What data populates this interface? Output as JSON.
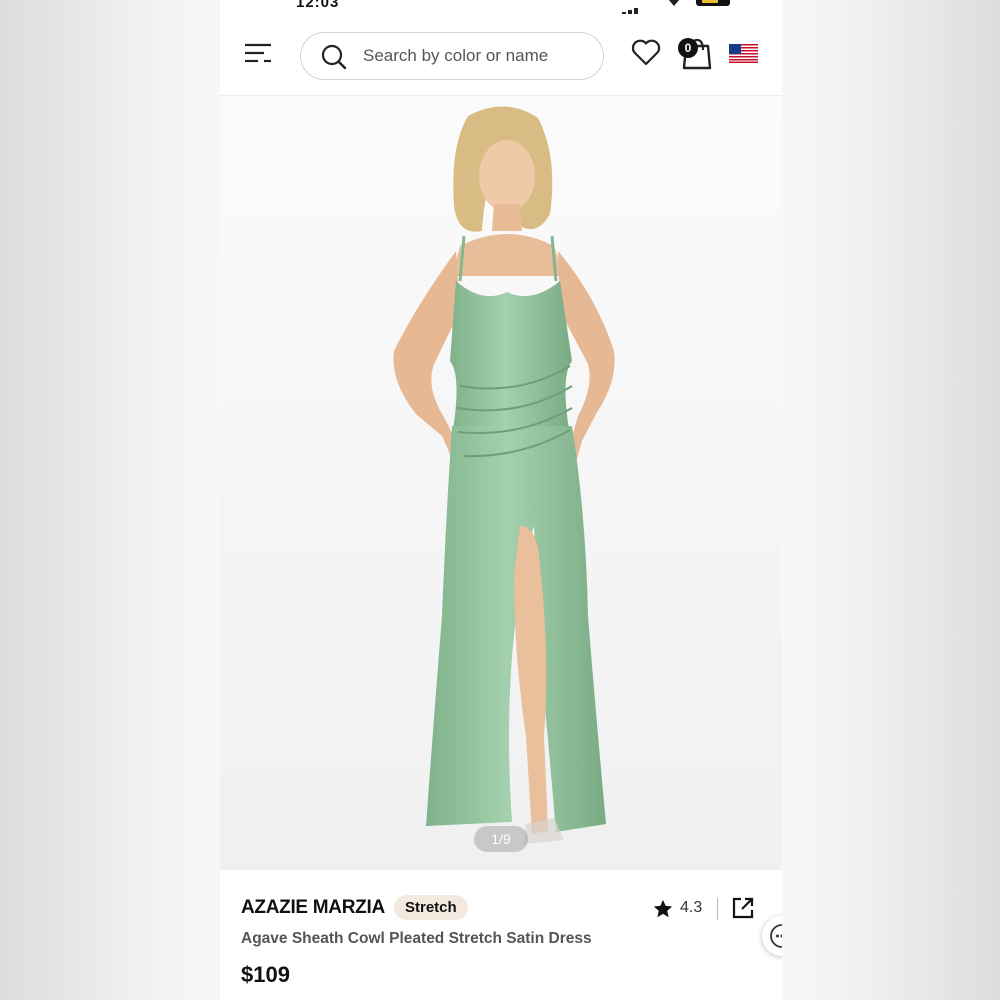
{
  "status_bar": {
    "time": "12:03",
    "icons": [
      "signal-icon",
      "wifi-icon",
      "battery-icon"
    ]
  },
  "header": {
    "menu_icon": "menu-filter-icon",
    "search": {
      "placeholder": "Search by color or name",
      "icon": "search-icon"
    },
    "wishlist_icon": "heart-icon",
    "cart": {
      "icon": "bag-icon",
      "count": "0"
    },
    "region_icon": "us-flag-icon"
  },
  "product": {
    "image_counter": "1/9",
    "brand": "AZAZIE MARZIA",
    "badge": "Stretch",
    "rating": "4.3",
    "name": "Agave Sheath Cowl Pleated Stretch Satin Dress",
    "price": "$109",
    "share_icon": "share-external-icon",
    "chat_icon": "chat-more-icon"
  },
  "colors": {
    "dress": "#8fbf99",
    "badge_bg": "#f3e9de",
    "text_primary": "#111111"
  }
}
